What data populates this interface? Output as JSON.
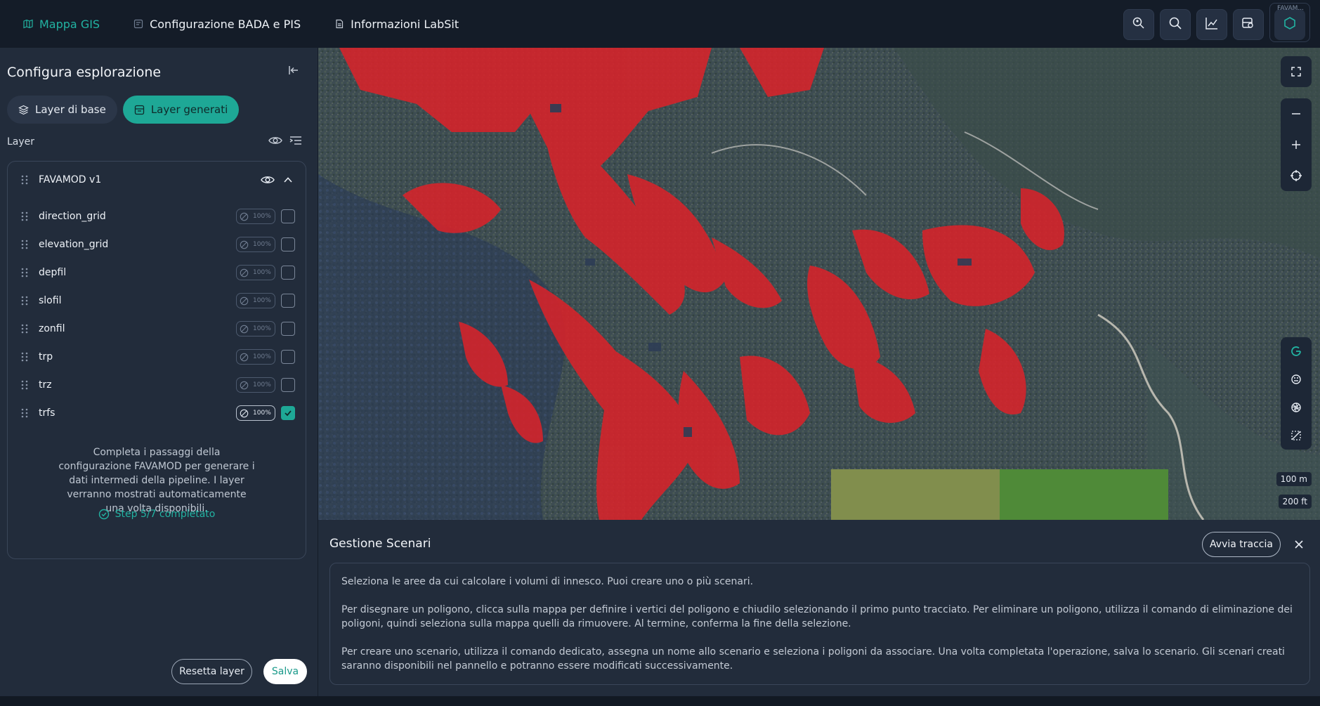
{
  "topbar": {
    "nav": [
      {
        "label": "Mappa GIS",
        "icon": "map-icon",
        "active": true
      },
      {
        "label": "Configurazione BADA e PIS",
        "icon": "config-icon",
        "active": false
      },
      {
        "label": "Informazioni LabSit",
        "icon": "info-doc-icon",
        "active": false
      }
    ],
    "tools": [
      "search-location-icon",
      "search-icon",
      "chart-icon",
      "layers-search-icon"
    ],
    "special_label": "FAVAM..."
  },
  "sidebar": {
    "title": "Configura esplorazione",
    "tabs": [
      {
        "label": "Layer di base",
        "active": false
      },
      {
        "label": "Layer generati",
        "active": true
      }
    ],
    "layer_label": "Layer",
    "group": {
      "name": "FAVAMOD v1",
      "layers": [
        {
          "name": "direction_grid",
          "opacity": "100",
          "checked": false
        },
        {
          "name": "elevation_grid",
          "opacity": "100",
          "checked": false
        },
        {
          "name": "depfil",
          "opacity": "100",
          "checked": false
        },
        {
          "name": "slofil",
          "opacity": "100",
          "checked": false
        },
        {
          "name": "zonfil",
          "opacity": "100",
          "checked": false
        },
        {
          "name": "trp",
          "opacity": "100",
          "checked": false
        },
        {
          "name": "trz",
          "opacity": "100",
          "checked": false
        },
        {
          "name": "trfs",
          "opacity": "100",
          "checked": true
        }
      ]
    },
    "info_text": "Completa i passaggi della configurazione FAVAMOD per generare i dati intermedi della pipeline. I layer verranno mostrati automaticamente una volta disponibili.",
    "step_text": "Step 5/7 completato",
    "reset_label": "Resetta layer",
    "save_label": "Salva"
  },
  "map": {
    "scale_metric": "100 m",
    "scale_imperial": "200 ft"
  },
  "scenari": {
    "title": "Gestione Scenari",
    "start_label": "Avvia traccia",
    "paragraphs": [
      "Seleziona le aree da cui calcolare i volumi di innesco. Puoi creare uno o più scenari.",
      "Per disegnare un poligono, clicca sulla mappa per definire i vertici del poligono e chiudilo selezionando il primo punto tracciato. Per eliminare un poligono, utilizza il comando di eliminazione dei poligoni, quindi seleziona sulla mappa quelli da rimuovere. Al termine, conferma la fine della selezione.",
      "Per creare uno scenario, utilizza il comando dedicato, assegna un nome allo scenario e seleziona i poligoni da associare. Una volta completata l'operazione, salva lo scenario. Gli scenari creati saranno disponibili nel pannello e potranno essere modificati successivamente."
    ]
  },
  "colors": {
    "accent": "#1ea896",
    "hazard": "#d8232a",
    "background": "#141c28",
    "panel": "#222c3b"
  }
}
